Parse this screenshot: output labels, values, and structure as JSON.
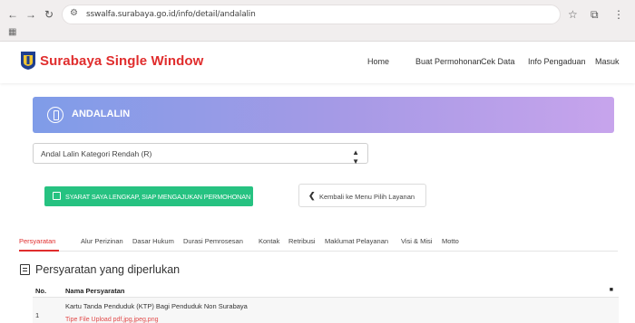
{
  "browser": {
    "url": "sswalfa.surabaya.go.id/info/detail/andalalin"
  },
  "header": {
    "brand": "Surabaya Single Window",
    "menu": [
      "Home",
      "Buat Permohonan",
      "Cek Data",
      "Info Pengaduan",
      "Masuk"
    ]
  },
  "banner": {
    "title": "ANDALALIN"
  },
  "service_select": {
    "value": "Andal Lalin Kategori Rendah (R)"
  },
  "actions": {
    "apply_label": "SYARAT SAYA LENGKAP, SIAP MENGAJUKAN PERMOHONAN",
    "back_label": "Kembali ke Menu Pilih Layanan"
  },
  "tabs": [
    "Persyaratan",
    "Alur Perizinan",
    "Dasar Hukum",
    "Durasi Pemrosesan",
    "Kontak",
    "Retribusi",
    "Maklumat Pelayanan",
    "Visi & Misi",
    "Motto"
  ],
  "requirements": {
    "title": "Persyaratan yang diperlukan",
    "columns": [
      "No.",
      "Nama Persyaratan"
    ],
    "rows": [
      {
        "no": "1",
        "name": "Kartu Tanda Penduduk (KTP) Bagi Penduduk Non Surabaya",
        "note": "Tipe File Upload pdf,jpg,jpeg,png"
      }
    ]
  },
  "colors": {
    "brand_red": "#e02d2d",
    "action_green": "#26c281",
    "banner_start": "#7f9ce8",
    "banner_end": "#c7a4ec"
  }
}
